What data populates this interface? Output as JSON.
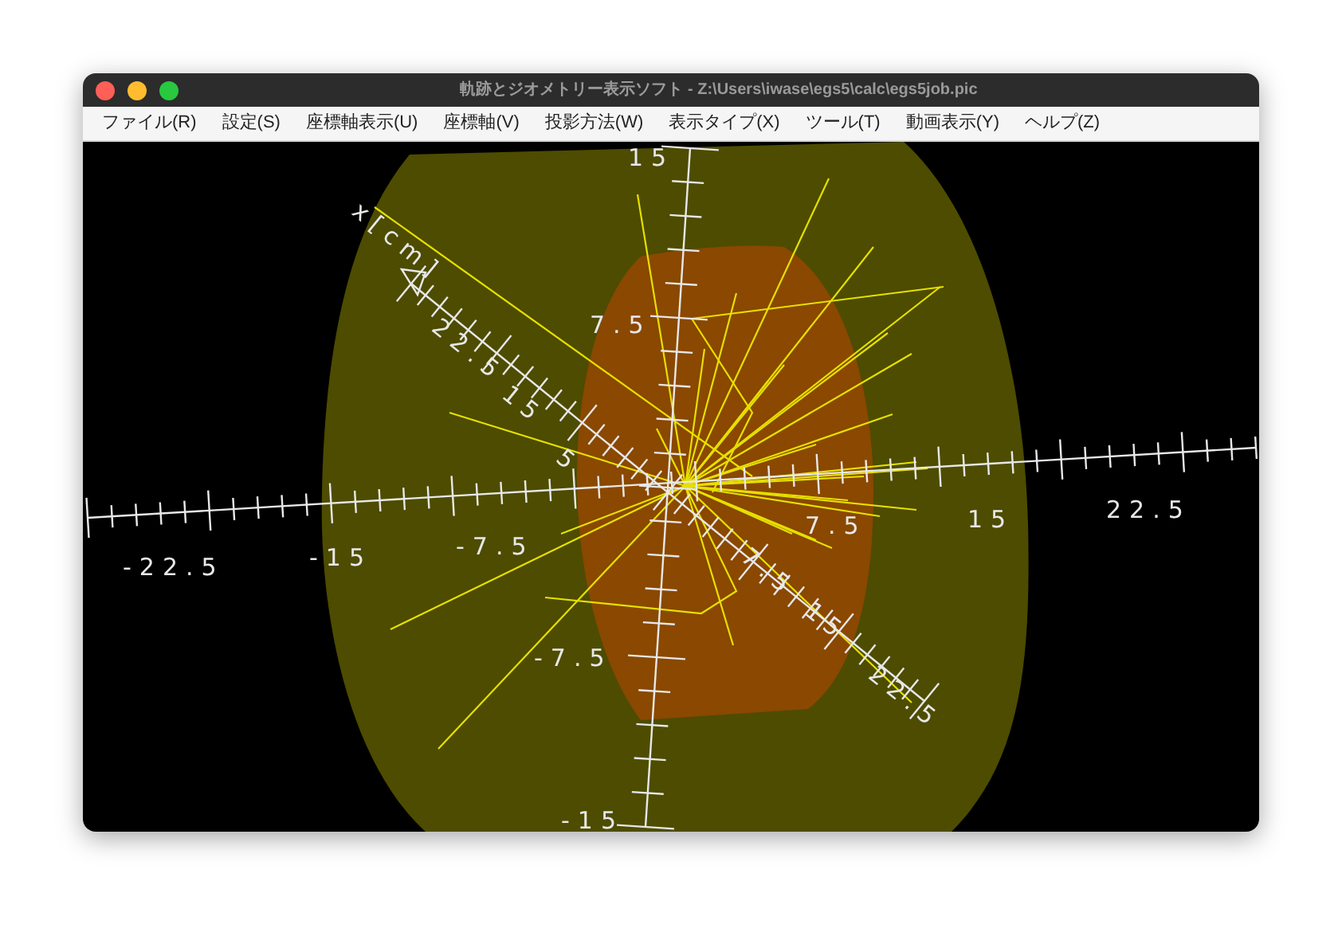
{
  "window": {
    "title": "軌跡とジオメトリー表示ソフト - Z:\\Users\\iwase\\egs5\\calc\\egs5job.pic"
  },
  "menu": [
    {
      "label": "ファイル(R)"
    },
    {
      "label": "設定(S)"
    },
    {
      "label": "座標軸表示(U)"
    },
    {
      "label": "座標軸(V)"
    },
    {
      "label": "投影方法(W)"
    },
    {
      "label": "表示タイプ(X)"
    },
    {
      "label": "ツール(T)"
    },
    {
      "label": "動画表示(Y)"
    },
    {
      "label": "ヘルプ(Z)"
    }
  ],
  "viewport": {
    "axis_labels": {
      "vertical": [
        "15",
        "7.5",
        "-7.5",
        "-15"
      ],
      "horizontal": [
        "-22.5",
        "-15",
        "-7.5",
        "7.5",
        "15",
        "22.5"
      ],
      "depth": [
        "x[cm]",
        "22.5",
        "15",
        "5",
        "7.5",
        "15",
        "22.5"
      ]
    }
  }
}
